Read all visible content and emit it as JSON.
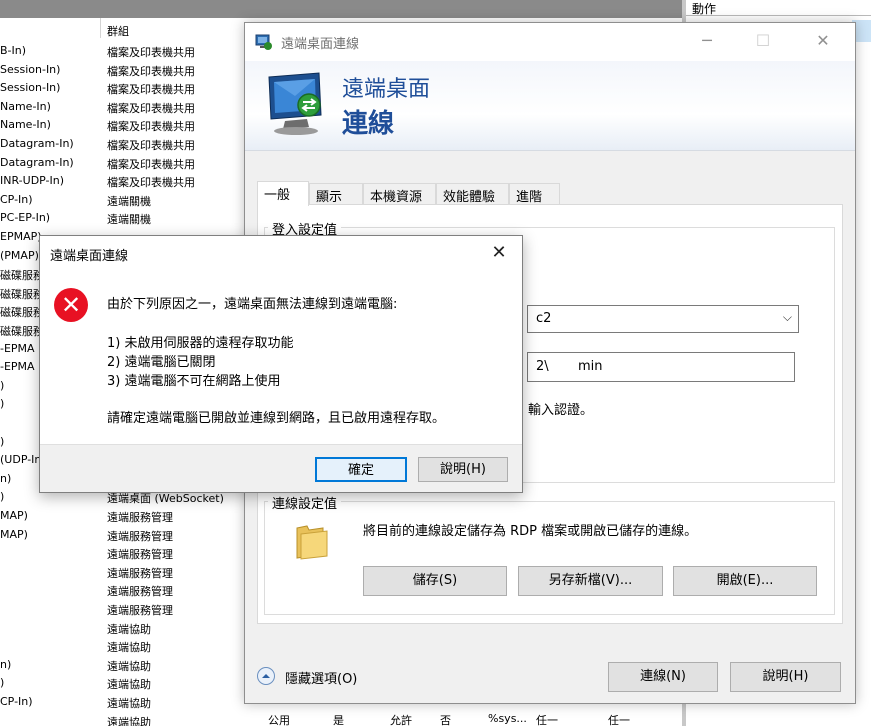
{
  "background": {
    "group_header": "群組",
    "rows": [
      {
        "name": "B-In)",
        "group": "檔案及印表機共用"
      },
      {
        "name": "Session-In)",
        "group": "檔案及印表機共用"
      },
      {
        "name": "Session-In)",
        "group": "檔案及印表機共用"
      },
      {
        "name": "Name-In)",
        "group": "檔案及印表機共用"
      },
      {
        "name": "Name-In)",
        "group": "檔案及印表機共用"
      },
      {
        "name": "Datagram-In)",
        "group": "檔案及印表機共用"
      },
      {
        "name": "Datagram-In)",
        "group": "檔案及印表機共用"
      },
      {
        "name": "INR-UDP-In)",
        "group": "檔案及印表機共用"
      },
      {
        "name": "CP-In)",
        "group": "遠端關機"
      },
      {
        "name": "PC-EP-In)",
        "group": "遠端關機"
      },
      {
        "name": "EPMAP)",
        "group": ""
      },
      {
        "name": "(PMAP)",
        "group": ""
      },
      {
        "name": "磁碟服務",
        "group": ""
      },
      {
        "name": "磁碟服務",
        "group": ""
      },
      {
        "name": "磁碟服務",
        "group": ""
      },
      {
        "name": "磁碟服務",
        "group": ""
      },
      {
        "name": "-EPMA",
        "group": ""
      },
      {
        "name": "-EPMA",
        "group": ""
      },
      {
        "name": ")",
        "group": ""
      },
      {
        "name": ")",
        "group": ""
      },
      {
        "name": "",
        "group": ""
      },
      {
        "name": ")",
        "group": ""
      },
      {
        "name": "(UDP-In",
        "group": ""
      },
      {
        "name": "n)",
        "group": ""
      },
      {
        "name": ")",
        "group": "遠端桌面 (WebSocket)"
      },
      {
        "name": "MAP)",
        "group": "遠端服務管理"
      },
      {
        "name": "MAP)",
        "group": "遠端服務管理"
      },
      {
        "name": "",
        "group": "遠端服務管理"
      },
      {
        "name": "",
        "group": "遠端服務管理"
      },
      {
        "name": "",
        "group": "遠端服務管理"
      },
      {
        "name": "",
        "group": "遠端服務管理"
      },
      {
        "name": "",
        "group": "遠端協助"
      },
      {
        "name": "",
        "group": "遠端協助"
      },
      {
        "name": "n)",
        "group": "遠端協助"
      },
      {
        "name": ")",
        "group": "遠端協助"
      },
      {
        "name": "CP-In)",
        "group": "遠端協助"
      },
      {
        "name": "",
        "group": "遠端協助"
      }
    ],
    "bottom_row": {
      "profile": "公用",
      "enabled": "是",
      "action": "允許",
      "override": "否",
      "program": "%sys...",
      "local": "任一",
      "remote": "任一"
    }
  },
  "actions_pane": {
    "title": "動作"
  },
  "rdc_window": {
    "title": "遠端桌面連線",
    "banner_line1": "遠端桌面",
    "banner_line2": "連線",
    "tabs": [
      "一般",
      "顯示",
      "本機資源",
      "效能體驗",
      "進階"
    ],
    "login_group_title": "登入設定值",
    "computer_value": "c2",
    "user_value_a": "2\\",
    "user_value_b": "min",
    "credentials_note": "輸入認證。",
    "connection_group_title": "連線設定值",
    "connection_desc": "將目前的連線設定儲存為 RDP 檔案或開啟已儲存的連線。",
    "save_label": "儲存(S)",
    "save_as_label": "另存新檔(V)...",
    "open_label": "開啟(E)...",
    "hide_options_label": "隱藏選項(O)",
    "connect_label": "連線(N)",
    "help_label": "說明(H)"
  },
  "error_dialog": {
    "title": "遠端桌面連線",
    "line_intro": "由於下列原因之一，遠端桌面無法連線到遠端電腦:",
    "line_1": "1) 未啟用伺服器的遠程存取功能",
    "line_2": "2) 遠端電腦已關閉",
    "line_3": "3) 遠端電腦不可在網路上使用",
    "line_advice": "請確定遠端電腦已開啟並連線到網路，且已啟用遠程存取。",
    "ok_label": "確定",
    "help_label": "說明(H)"
  }
}
